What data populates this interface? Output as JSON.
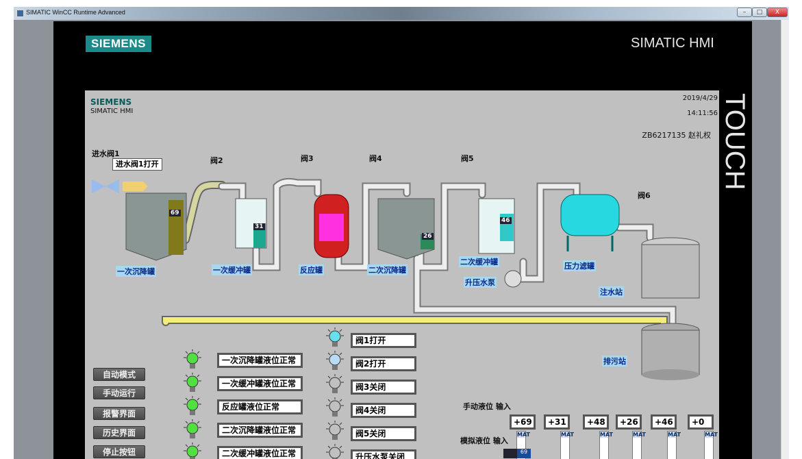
{
  "window": {
    "title": "SIMATIC WinCC Runtime Advanced",
    "min": "–",
    "max": "□",
    "close": "X"
  },
  "frame": {
    "logo": "SIEMENS",
    "brand": "SIMATIC HMI",
    "touch": "TOUCH"
  },
  "screen": {
    "logo": "SIEMENS",
    "subtitle": "SIMATIC HMI",
    "date": "2019/4/29",
    "time": "14:11:56",
    "user": "ZB6217135  赵礼权",
    "valve_labels": {
      "v1": "进水阀1",
      "v1_status": "进水阀1打开",
      "v2": "阀2",
      "v3": "阀3",
      "v4": "阀4",
      "v5": "阀5",
      "v6": "阀6"
    },
    "equipment": {
      "t1": "一次沉降罐",
      "t2": "一次缓冲罐",
      "t3": "反应罐",
      "t4": "二次沉降罐",
      "t5": "二次缓冲罐",
      "pump": "升压水泵",
      "filter": "压力滤罐",
      "inject": "注水站",
      "sewage": "排污站"
    },
    "tank_levels": {
      "t1": "69",
      "t2": "31",
      "t4": "26",
      "t5": "46"
    },
    "nav_buttons": [
      "自动模式",
      "手动运行",
      "报警界面",
      "历史界面",
      "停止按钮"
    ],
    "level_status": [
      "一次沉降罐液位正常",
      "一次缓冲罐液位正常",
      "反应罐液位正常",
      "二次沉降罐液位正常",
      "二次缓冲罐液位正常"
    ],
    "valve_status": [
      {
        "text": "阀1打开",
        "color": "#66e0ee"
      },
      {
        "text": "阀2打开",
        "color": "#b8dcf6"
      },
      {
        "text": "阀3关闭",
        "color": "#c0c0c0"
      },
      {
        "text": "阀4关闭",
        "color": "#c0c0c0"
      },
      {
        "text": "阀5关闭",
        "color": "#c0c0c0"
      },
      {
        "text": "升压水泵关闭",
        "color": "#c0c0c0"
      }
    ],
    "manual_label": "手动液位  输入",
    "sim_label": "模拟液位  输入",
    "manual_inputs": [
      "+69",
      "+31",
      "+48",
      "+26",
      "+46",
      "+0"
    ],
    "slider_header": "MAT",
    "slider_value": "69"
  }
}
